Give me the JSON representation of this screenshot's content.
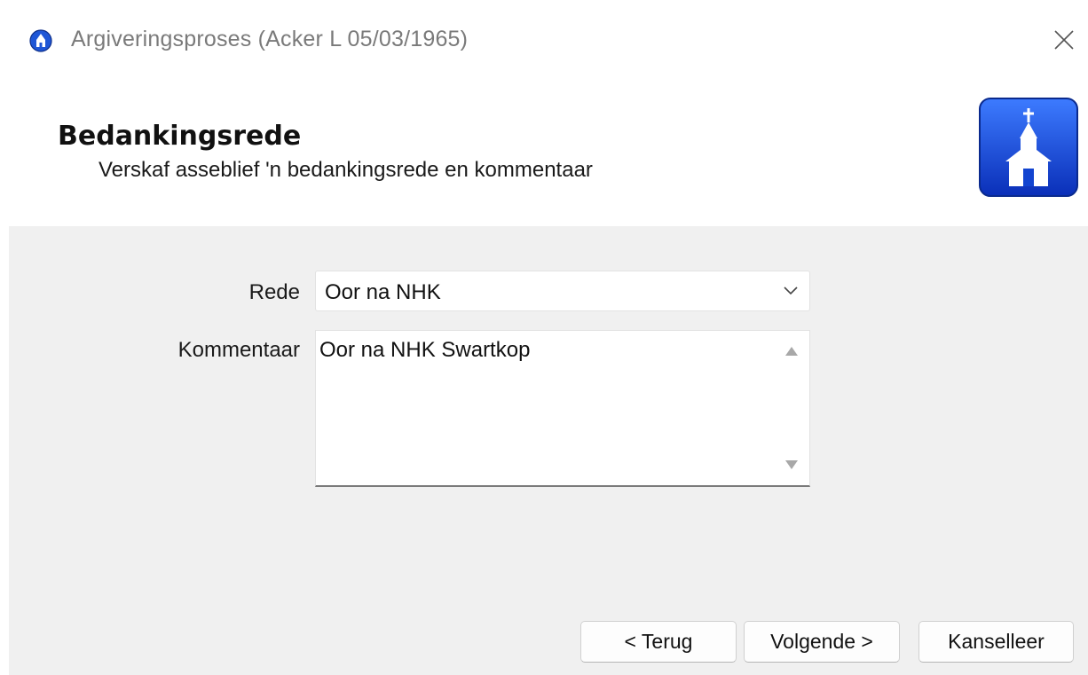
{
  "window": {
    "title": "Argiveringsproses (Acker  L 05/03/1965)",
    "app_icon": "church-app-icon",
    "close_icon": "close-icon"
  },
  "header": {
    "title": "Bedankingsrede",
    "subtitle": "Verskaf asseblief 'n bedankingsrede en kommentaar",
    "logo_icon": "church-logo-icon",
    "logo_color": "#1a4fd8"
  },
  "form": {
    "rede_label": "Rede",
    "rede_value": "Oor na NHK",
    "kommentaar_label": "Kommentaar",
    "kommentaar_value": "Oor na NHK Swartkop"
  },
  "buttons": {
    "back": "< Terug",
    "next": "Volgende >",
    "cancel": "Kanselleer"
  }
}
